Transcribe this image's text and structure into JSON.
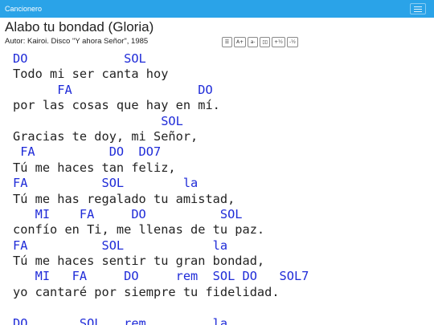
{
  "navbar": {
    "brand": "Cancionero",
    "menu_icon": "hamburger-icon",
    "color": "#2aa3e8"
  },
  "song": {
    "title": "Alabo tu bondad (Gloria)",
    "author": "Autor: Kairoi. Disco \"Y ahora Señor\", 1985"
  },
  "toolbar": [
    {
      "name": "columns-button",
      "label": "☰"
    },
    {
      "name": "font-increase-button",
      "label": "A+"
    },
    {
      "name": "font-decrease-button",
      "label": "a-"
    },
    {
      "name": "layout-button",
      "label": "▯▯"
    },
    {
      "name": "transpose-up-button",
      "label": "+½"
    },
    {
      "name": "transpose-down-button",
      "label": "-½"
    }
  ],
  "chord_color": "#1f2bd8",
  "lines": [
    {
      "type": "chords",
      "text": "DO             SOL"
    },
    {
      "type": "lyrics",
      "text": "Todo mi ser canta hoy"
    },
    {
      "type": "chords",
      "text": "      FA                 DO"
    },
    {
      "type": "lyrics",
      "text": "por las cosas que hay en mí."
    },
    {
      "type": "chords",
      "text": "                    SOL"
    },
    {
      "type": "lyrics",
      "text": "Gracias te doy, mi Señor,"
    },
    {
      "type": "chords",
      "text": " FA          DO  DO7"
    },
    {
      "type": "lyrics",
      "text": "Tú me haces tan feliz,"
    },
    {
      "type": "chords",
      "text": "FA          SOL        la"
    },
    {
      "type": "lyrics",
      "text": "Tú me has regalado tu amistad,"
    },
    {
      "type": "chords",
      "text": "   MI    FA     DO          SOL"
    },
    {
      "type": "lyrics",
      "text": "confío en Ti, me llenas de tu paz."
    },
    {
      "type": "chords",
      "text": "FA          SOL            la"
    },
    {
      "type": "lyrics",
      "text": "Tú me haces sentir tu gran bondad,"
    },
    {
      "type": "chords",
      "text": "   MI   FA     DO     rem  SOL DO   SOL7"
    },
    {
      "type": "lyrics",
      "text": "yo cantaré por siempre tu fidelidad."
    },
    {
      "type": "blank",
      "text": ""
    },
    {
      "type": "chords",
      "text": "DO       SOL   rem         la"
    }
  ]
}
